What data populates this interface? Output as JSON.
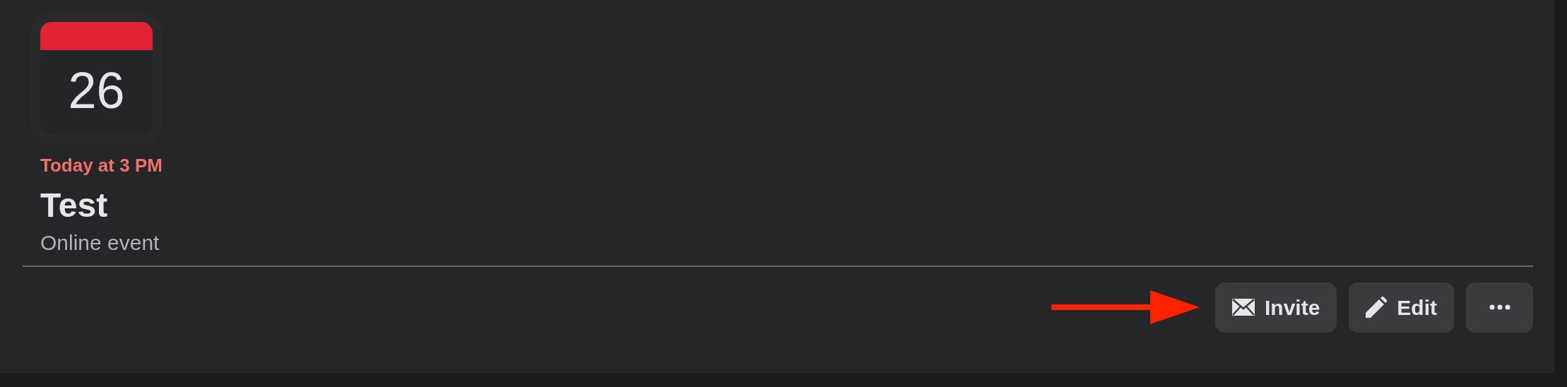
{
  "event": {
    "date_badge": {
      "day": "26"
    },
    "time": "Today at 3 PM",
    "title": "Test",
    "location": "Online event"
  },
  "actions": [
    {
      "kind": "invite",
      "label": "Invite"
    },
    {
      "kind": "edit",
      "label": "Edit"
    },
    {
      "kind": "more"
    }
  ]
}
